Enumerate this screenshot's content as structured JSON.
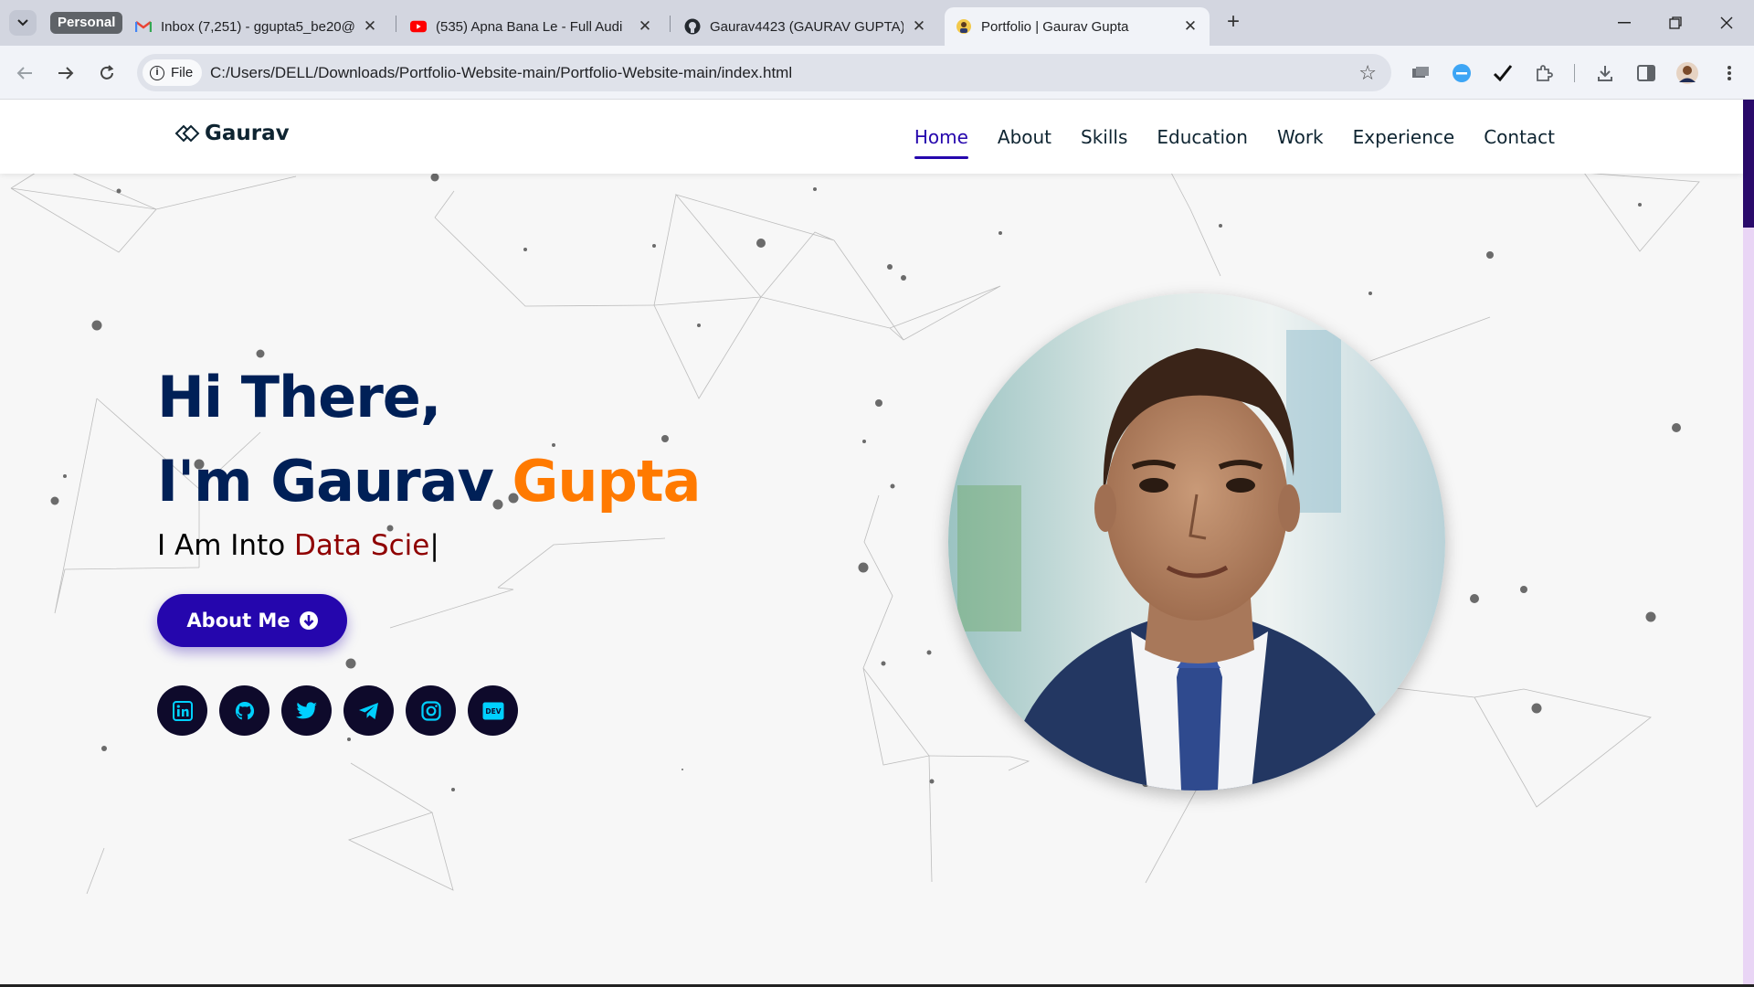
{
  "browser": {
    "profile_chip": "Personal",
    "tabs": [
      {
        "title": "Inbox (7,251) - ggupta5_be20@",
        "icon": "gmail-icon",
        "active": false
      },
      {
        "title": "(535) Apna Bana Le - Full Audi",
        "icon": "youtube-icon",
        "active": false
      },
      {
        "title": "Gaurav4423 (GAURAV GUPTA)",
        "icon": "github-icon",
        "active": false
      },
      {
        "title": "Portfolio | Gaurav Gupta",
        "icon": "portfolio-favicon",
        "active": true
      }
    ],
    "address": {
      "chip": "File",
      "url": "C:/Users/DELL/Downloads/Portfolio-Website-main/Portfolio-Website-main/index.html"
    }
  },
  "site": {
    "logo": "Gaurav",
    "nav": [
      "Home",
      "About",
      "Skills",
      "Education",
      "Work",
      "Experience",
      "Contact"
    ],
    "nav_active": "Home",
    "hero": {
      "greeting": "Hi There,",
      "name_prefix": "I'm Gaurav ",
      "name_accent": "Gupta",
      "typed_prefix": "I Am Into ",
      "typed_role": "Data Scie",
      "cursor": "|",
      "button": "About Me"
    },
    "socials": [
      "linkedin-icon",
      "github-icon",
      "twitter-icon",
      "telegram-icon",
      "instagram-icon",
      "dev-icon"
    ],
    "dev_label": "DEV"
  },
  "colors": {
    "brand": "#2506ad",
    "heading": "#002057",
    "accent": "#ff7a00",
    "role": "#8f0000",
    "social_bg": "#0e0a2b",
    "social_icon": "#00d0ff"
  }
}
